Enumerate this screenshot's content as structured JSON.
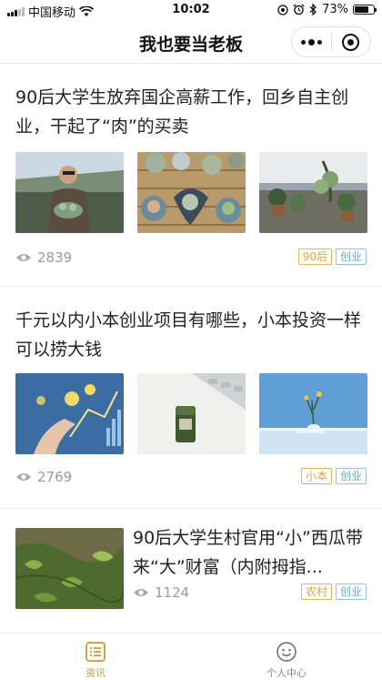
{
  "status_bar": {
    "carrier": "中国移动",
    "time": "10:02",
    "battery": "73%",
    "battery_level": 0.73
  },
  "nav": {
    "title": "我也要当老板"
  },
  "articles": [
    {
      "title": "90后大学生放弃国企高薪工作，回乡自主创业，干起了“肉”的买卖",
      "views": "2839",
      "tags": [
        "90后",
        "创业"
      ],
      "images": [
        "man-holding-succulents-photo",
        "succulent-pots-photo",
        "potted-plants-photo"
      ]
    },
    {
      "title": "千元以内小本创业项目有哪些，小本投资一样可以捞大钱",
      "views": "2769",
      "tags": [
        "小本",
        "创业"
      ],
      "images": [
        "hand-with-coins-photo",
        "coin-stack-keyboard-photo",
        "glass-vase-plant-photo"
      ]
    },
    {
      "title": "90后大学生村官用“小”西瓜带来“大”财富（内附拇指...",
      "views": "1124",
      "tags": [
        "农村",
        "创业"
      ],
      "images": [
        "watermelon-vines-photo"
      ]
    }
  ],
  "tab_bar": {
    "items": [
      {
        "label": "资讯",
        "icon": "news-list-icon",
        "active": true
      },
      {
        "label": "个人中心",
        "icon": "smiley-face-icon",
        "active": false
      }
    ]
  },
  "colors": {
    "accent": "#d09a2c",
    "tag_gold": "#e2a33a",
    "tag_blue": "#6aa7cf"
  }
}
